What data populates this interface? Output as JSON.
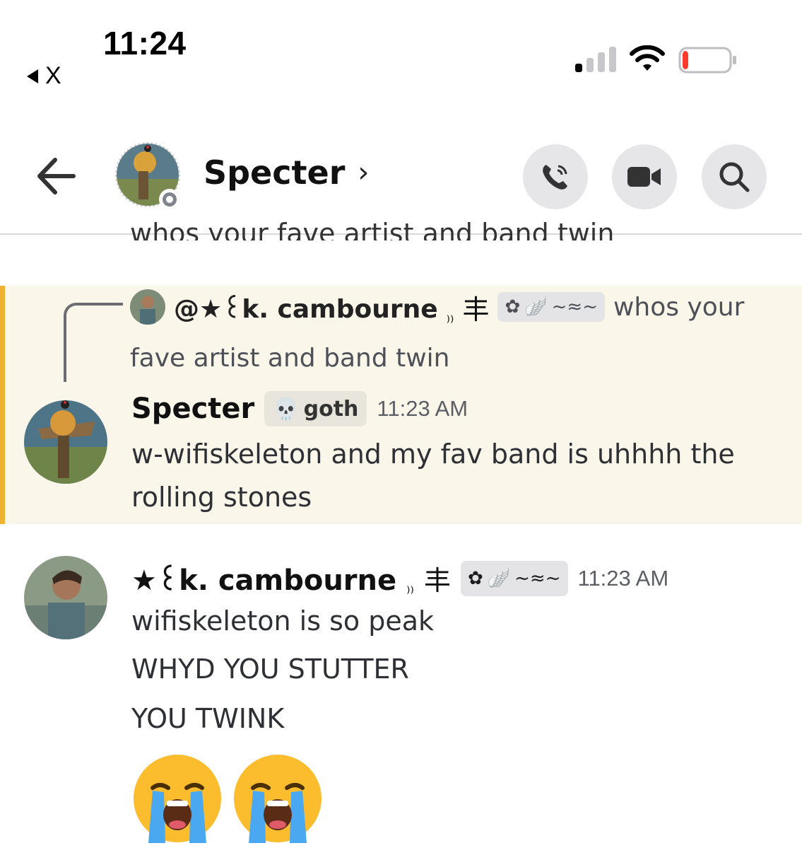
{
  "status_bar": {
    "time": "11:24",
    "back_app": "X",
    "battery_level": 0.1
  },
  "header": {
    "title": "Specter",
    "chevron": "›",
    "call_icon": "phone-icon",
    "video_icon": "video-icon",
    "search_icon": "search-icon"
  },
  "partial_message": "whos your fave artist and band twin",
  "reply": {
    "mention": "@★꒰k. cambourne",
    "suffix_mark": "₎₎",
    "glyph": "丰",
    "text_start": "whos your",
    "text_cont": "fave artist and band twin"
  },
  "message1": {
    "author": "Specter",
    "role": "goth",
    "timestamp": "11:23 AM",
    "text": "w-wifiskeleton and my fav band is uhhhh the rolling stones"
  },
  "message2": {
    "author": "★꒰k. cambourne",
    "suffix_mark": "₎₎",
    "glyph": "丰",
    "timestamp": "11:23 AM",
    "lines": [
      "wifiskeleton is so peak",
      "WHYD YOU STUTTER",
      "YOU TWINK"
    ],
    "emojis": [
      "😭",
      "😭"
    ]
  },
  "colors": {
    "highlight_bg": "#fbf6ea",
    "highlight_bar": "#f0b232",
    "button_bg": "#e6e6e9"
  }
}
